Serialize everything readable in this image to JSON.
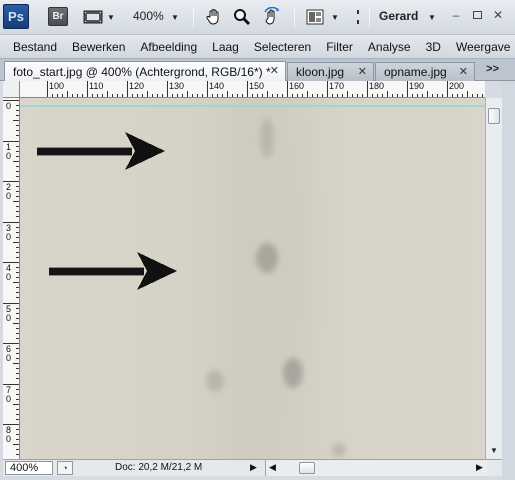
{
  "app": {
    "logo": "Ps",
    "bridge_logo": "Br",
    "zoom_popup": "400%",
    "workspace": "Gerard",
    "window_controls": [
      "minimize",
      "restore",
      "close"
    ]
  },
  "toolbar_icons": [
    "photoshop-logo",
    "bridge-logo",
    "screen-mode-icon",
    "zoom-level-dropdown",
    "hand-tool-icon",
    "zoom-tool-icon",
    "rotate-view-icon",
    "arrange-documents-icon",
    "screen-mode-extra-icon"
  ],
  "menu": [
    "Bestand",
    "Bewerken",
    "Afbeelding",
    "Laag",
    "Selecteren",
    "Filter",
    "Analyse",
    "3D",
    "Weergave"
  ],
  "tabs": [
    {
      "label": "foto_start.jpg @ 400% (Achtergrond, RGB/16*) *",
      "active": true
    },
    {
      "label": "kloon.jpg",
      "active": false
    },
    {
      "label": "opname.jpg",
      "active": false
    }
  ],
  "tab_overflow": ">>",
  "ruler_top_labels": [
    "100",
    "110",
    "120",
    "130",
    "140",
    "150",
    "160",
    "170",
    "180",
    "190",
    "200"
  ],
  "ruler_left_labels": [
    "0",
    "1 0",
    "2 0",
    "3 0",
    "4 0",
    "5 0",
    "6 0",
    "7 0",
    "8 0"
  ],
  "status": {
    "zoom": "400%",
    "doc_info": "Doc: 20,2 M/21,2 M"
  },
  "colors": {
    "accent_blue": "#2b5fa6",
    "canvas": "#d7d3c9",
    "guide": "#8fd8d8"
  }
}
